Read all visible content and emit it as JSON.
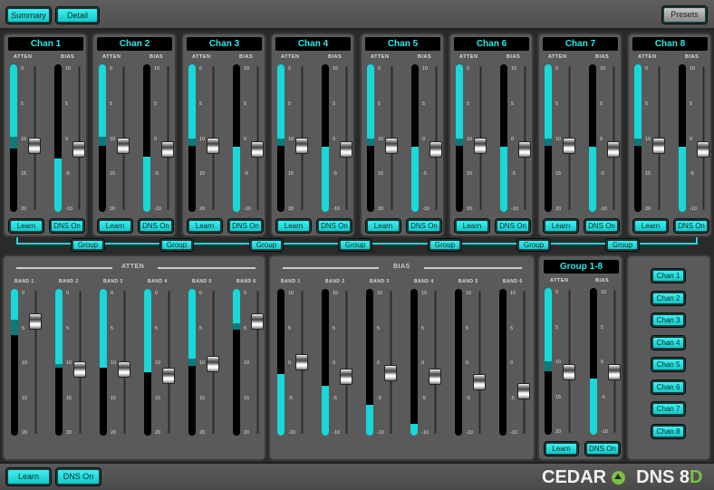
{
  "topbar": {
    "summary": "Summary",
    "detail": "Detail",
    "presets": "Presets"
  },
  "labels": {
    "atten": "ATTEN",
    "bias": "BIAS",
    "learn": "Learn",
    "dns_on": "DNS On",
    "group": "Group"
  },
  "atten_ticks": [
    "0",
    "5",
    "10",
    "15",
    "20"
  ],
  "bias_ticks": [
    "10",
    "5",
    "0",
    "-5",
    "-10"
  ],
  "channels": [
    {
      "name": "Chan 1",
      "atten_level": 9.8,
      "atten_hold": 11.4,
      "atten_fader": 11,
      "bias_level": -2.8,
      "bias_fader": -1.5
    },
    {
      "name": "Chan 2",
      "atten_level": 9.8,
      "atten_hold": 11.0,
      "atten_fader": 11,
      "bias_level": -2.5,
      "bias_fader": -1.5
    },
    {
      "name": "Chan 3",
      "atten_level": 10,
      "atten_hold": 11.0,
      "atten_fader": 11,
      "bias_level": -1.2,
      "bias_fader": -1.5
    },
    {
      "name": "Chan 4",
      "atten_level": 10,
      "atten_hold": 11.0,
      "atten_fader": 11,
      "bias_level": -1.2,
      "bias_fader": -1.5
    },
    {
      "name": "Chan 5",
      "atten_level": 10,
      "atten_hold": 11.0,
      "atten_fader": 11,
      "bias_level": -1.2,
      "bias_fader": -1.5
    },
    {
      "name": "Chan 6",
      "atten_level": 10,
      "atten_hold": 11.0,
      "atten_fader": 11,
      "bias_level": -1.2,
      "bias_fader": -1.5
    },
    {
      "name": "Chan 7",
      "atten_level": 10,
      "atten_hold": 11.0,
      "atten_fader": 11,
      "bias_level": -1.2,
      "bias_fader": -1.5
    },
    {
      "name": "Chan 8",
      "atten_level": 10,
      "atten_hold": 11.0,
      "atten_fader": 11,
      "bias_level": -1.2,
      "bias_fader": -1.5
    }
  ],
  "atten_bands": [
    {
      "name": "BAND 1",
      "level": 4.2,
      "hold": 6.3,
      "fader": 4.5
    },
    {
      "name": "BAND 2",
      "level": 10.2,
      "hold": 10.7,
      "fader": 11
    },
    {
      "name": "BAND 3",
      "level": 10.8,
      "hold": 10.8,
      "fader": 11
    },
    {
      "name": "BAND 4",
      "level": 11.3,
      "hold": 11.3,
      "fader": 11.8
    },
    {
      "name": "BAND 5",
      "level": 9.5,
      "hold": 10.5,
      "fader": 10.3
    },
    {
      "name": "BAND 6",
      "level": 4.7,
      "hold": 5.5,
      "fader": 4.5
    }
  ],
  "bias_bands": [
    {
      "name": "BAND 1",
      "level": -1.6,
      "fader": 0
    },
    {
      "name": "BAND 2",
      "level": -3.2,
      "fader": -2
    },
    {
      "name": "BAND 3",
      "level": -5.8,
      "fader": -1.5
    },
    {
      "name": "BAND 4",
      "level": -8.4,
      "fader": -2
    },
    {
      "name": "BAND 5",
      "level": -10,
      "fader": -2.7
    },
    {
      "name": "BAND 6",
      "level": -10,
      "fader": -4
    }
  ],
  "group": {
    "title": "Group 1-8",
    "atten_level": 10,
    "atten_hold": 11.3,
    "atten_fader": 11.5,
    "bias_level": -2.3,
    "bias_fader": -1.5
  },
  "chan_select": [
    "Chan 1",
    "Chan 2",
    "Chan 3",
    "Chan 4",
    "Chan 5",
    "Chan 6",
    "Chan 7",
    "Chan 8"
  ],
  "bottombar": {
    "learn": "Learn",
    "dns_on": "DNS On"
  },
  "logo": {
    "brand": "CEDAR",
    "product": "DNS 8",
    "suffix": "D"
  },
  "colors": {
    "accent": "#18d8d8",
    "logo_green": "#7bc043"
  }
}
